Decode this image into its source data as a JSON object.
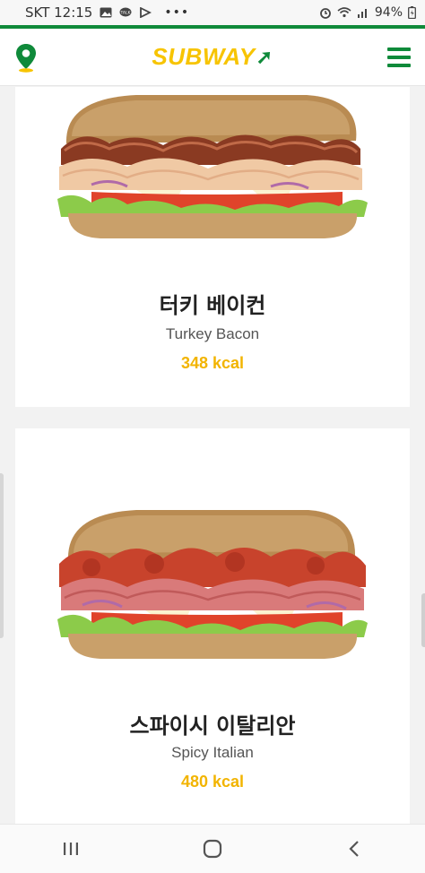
{
  "status_bar": {
    "carrier_time": "SKT 12:15",
    "battery": "94%",
    "icons": [
      "gallery-icon",
      "talk-icon",
      "flag-icon",
      "more-icon",
      "alarm-icon",
      "wifi-icon",
      "signal-icon",
      "battery-icon"
    ]
  },
  "header": {
    "logo_text": "SUBWAY",
    "left_icon": "location-pin-icon",
    "right_icon": "hamburger-menu-icon"
  },
  "menu_items": [
    {
      "name_ko": "터키 베이컨",
      "name_en": "Turkey Bacon",
      "kcal": "348 kcal"
    },
    {
      "name_ko": "스파이시 이탈리안",
      "name_en": "Spicy Italian",
      "kcal": "480 kcal"
    }
  ],
  "nav_bar": {
    "buttons": [
      "recent-apps-icon",
      "home-icon",
      "back-icon"
    ]
  },
  "colors": {
    "brand_green": "#0f8a3a",
    "brand_yellow": "#f7c400",
    "kcal_yellow": "#f2b400"
  }
}
